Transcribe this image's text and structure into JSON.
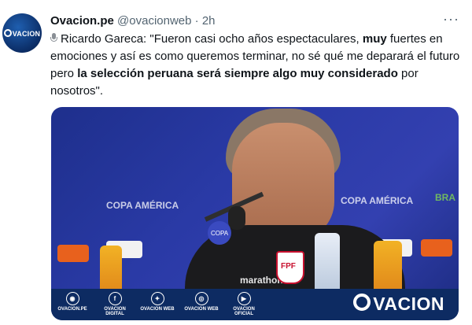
{
  "tweet": {
    "author_name": "Ovacion.pe",
    "author_handle": "@ovacionweb",
    "separator": "·",
    "time": "2h",
    "more_label": "···",
    "avatar_text": "VACION",
    "text_parts": [
      "Ricardo Gareca: \"Fueron casi ocho años espectaculares, ",
      "muy",
      " fuertes en emociones y así es como queremos terminar, no sé qué me deparará el futuro pero ",
      "la selección peruana será siempre algo muy considerado",
      " por nosotros\"."
    ]
  },
  "media": {
    "bg_labels": [
      "COPA AMÉRICA",
      "COPA AMÉRICA",
      "BRA"
    ],
    "shirt_brand": "marathon",
    "crest_text": "FPF",
    "mic_label": "COPA",
    "social": [
      {
        "icon": "ovacion-icon",
        "glyph": "◉",
        "label": "OVACION.PE"
      },
      {
        "icon": "facebook-icon",
        "glyph": "f",
        "label": "OVACION DIGITAL"
      },
      {
        "icon": "twitter-icon",
        "glyph": "✦",
        "label": "OVACION WEB"
      },
      {
        "icon": "instagram-icon",
        "glyph": "◎",
        "label": "OVACION WEB"
      },
      {
        "icon": "youtube-icon",
        "glyph": "▶",
        "label": "OVACION OFICIAL"
      }
    ],
    "brand_logo": "VACION"
  }
}
